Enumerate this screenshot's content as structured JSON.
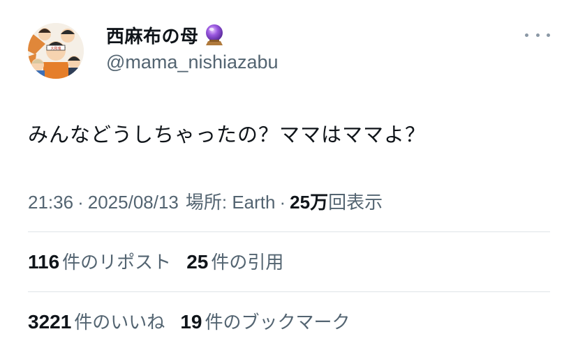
{
  "author": {
    "display_name": "西麻布の母",
    "handle": "@mama_nishiazabu",
    "badge_emoji_icon": "crystal-ball-icon"
  },
  "tweet": {
    "text": "みんなどうしちゃったの？ママはママよ？"
  },
  "meta": {
    "time": "21:36",
    "dot1": "·",
    "date": "2025/08/13",
    "location_label": "場所: Earth",
    "dot2": "·",
    "views_count": "25万",
    "views_label": "回表示"
  },
  "stats_row1": [
    {
      "count": "116",
      "label": "件のリポスト"
    },
    {
      "count": "25",
      "label": "件の引用"
    }
  ],
  "stats_row2": [
    {
      "count": "3221",
      "label": "件のいいね"
    },
    {
      "count": "19",
      "label": "件のブックマーク"
    }
  ],
  "colors": {
    "text_primary": "#0f1419",
    "text_secondary": "#536471",
    "divider": "#dfe3e7",
    "orb_purple": "#8a4fd6"
  }
}
